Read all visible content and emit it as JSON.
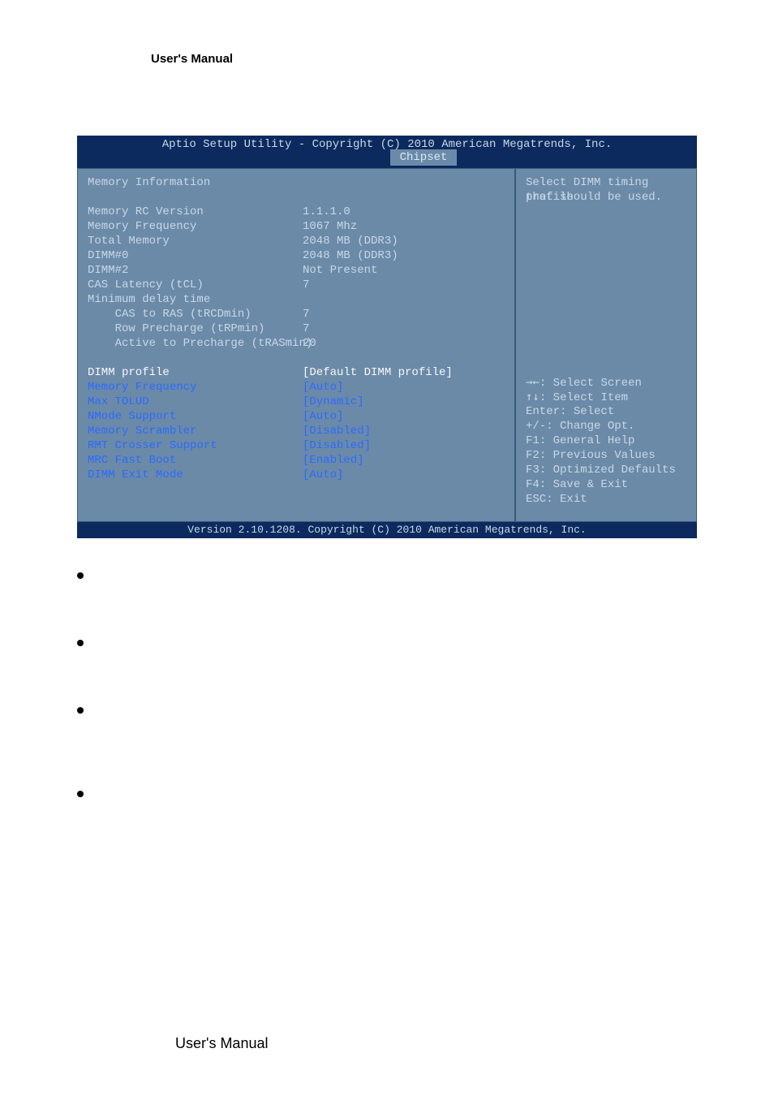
{
  "document": {
    "header": "User's Manual",
    "footer": "User's Manual"
  },
  "bios": {
    "title": "Aptio Setup Utility - Copyright (C) 2010 American Megatrends, Inc.",
    "tab": "Chipset",
    "footer": "Version 2.10.1208. Copyright (C) 2010 American Megatrends, Inc.",
    "main": {
      "section_title": "Memory Information",
      "info_rows": [
        {
          "label": "Memory RC Version",
          "value": "1.1.1.0"
        },
        {
          "label": "Memory Frequency",
          "value": "1067 Mhz"
        },
        {
          "label": "Total Memory",
          "value": "2048 MB (DDR3)"
        },
        {
          "label": "DIMM#0",
          "value": "2048 MB (DDR3)"
        },
        {
          "label": "DIMM#2",
          "value": "Not Present"
        },
        {
          "label": "CAS Latency (tCL)",
          "value": "7"
        },
        {
          "label": "Minimum delay time",
          "value": ""
        },
        {
          "label": "    CAS to RAS (tRCDmin)",
          "value": "7"
        },
        {
          "label": "    Row Precharge (tRPmin)",
          "value": "7"
        },
        {
          "label": "    Active to Precharge (tRASmin)",
          "value": "20"
        }
      ],
      "setting_rows": [
        {
          "label": "DIMM profile",
          "value": "[Default DIMM profile]",
          "highlighted": true
        },
        {
          "label": "Memory Frequency",
          "value": "[Auto]"
        },
        {
          "label": "Max TOLUD",
          "value": "[Dynamic]"
        },
        {
          "label": "NMode Support",
          "value": "[Auto]"
        },
        {
          "label": "Memory Scrambler",
          "value": "[Disabled]"
        },
        {
          "label": "RMT Crosser Support",
          "value": "[Disabled]"
        },
        {
          "label": "MRC Fast Boot",
          "value": "[Enabled]"
        },
        {
          "label": "DIMM Exit Mode",
          "value": "[Auto]"
        }
      ]
    },
    "help": {
      "description_line1": "Select DIMM timing profile",
      "description_line2": "that should be used.",
      "keys": [
        {
          "key": "→←",
          "action": ": Select Screen"
        },
        {
          "key": "↑↓",
          "action": ": Select Item"
        },
        {
          "key": "Enter",
          "action": ": Select"
        },
        {
          "key": "+/-",
          "action": ": Change Opt."
        },
        {
          "key": "F1",
          "action": ": General Help"
        },
        {
          "key": "F2",
          "action": ": Previous Values"
        },
        {
          "key": "F3",
          "action": ": Optimized Defaults"
        },
        {
          "key": "F4",
          "action": ": Save & Exit"
        },
        {
          "key": "ESC",
          "action": ": Exit"
        }
      ]
    }
  }
}
